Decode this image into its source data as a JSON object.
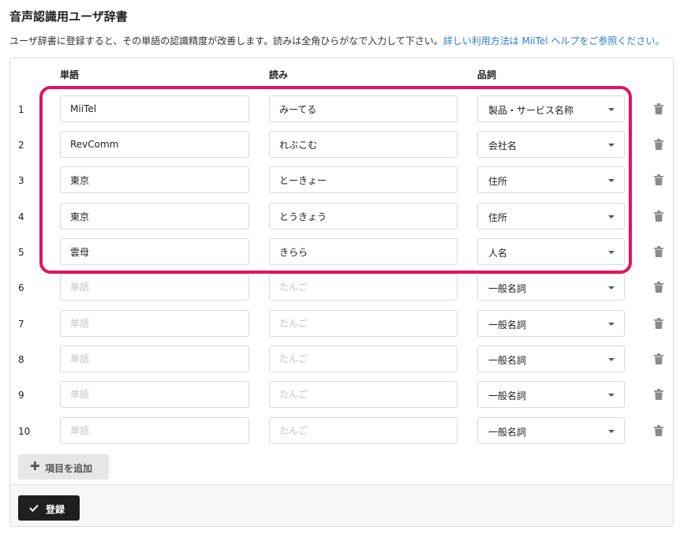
{
  "page": {
    "title": "音声認識用ユーザ辞書",
    "description": "ユーザ辞書に登録すると、その単語の認識精度が改善します。読みは全角ひらがなで入力して下さい。",
    "help_link": "詳しい利用方法は MiiTel ヘルプをご参照ください。"
  },
  "table": {
    "headers": {
      "word": "単語",
      "reading": "読み",
      "pos": "品詞"
    },
    "placeholders": {
      "word": "単語",
      "reading": "たんご"
    },
    "rows": [
      {
        "num": "1",
        "word": "MiiTel",
        "reading": "みーてる",
        "pos": "製品・サービス名称"
      },
      {
        "num": "2",
        "word": "RevComm",
        "reading": "れぶこむ",
        "pos": "会社名"
      },
      {
        "num": "3",
        "word": "東京",
        "reading": "とーきょー",
        "pos": "住所"
      },
      {
        "num": "4",
        "word": "東京",
        "reading": "とうきょう",
        "pos": "住所"
      },
      {
        "num": "5",
        "word": "雲母",
        "reading": "きらら",
        "pos": "人名"
      },
      {
        "num": "6",
        "word": "",
        "reading": "",
        "pos": "一般名詞"
      },
      {
        "num": "7",
        "word": "",
        "reading": "",
        "pos": "一般名詞"
      },
      {
        "num": "8",
        "word": "",
        "reading": "",
        "pos": "一般名詞"
      },
      {
        "num": "9",
        "word": "",
        "reading": "",
        "pos": "一般名詞"
      },
      {
        "num": "10",
        "word": "",
        "reading": "",
        "pos": "一般名詞"
      }
    ]
  },
  "actions": {
    "add_item": "項目を追加",
    "register": "登録"
  },
  "colors": {
    "highlight": "#e0145f",
    "link": "#2b7bd0",
    "primary_button": "#1f1f1f"
  },
  "icons": {
    "delete": "trash-icon",
    "add": "plus-icon",
    "submit": "check-icon",
    "dropdown": "caret-down-icon"
  }
}
